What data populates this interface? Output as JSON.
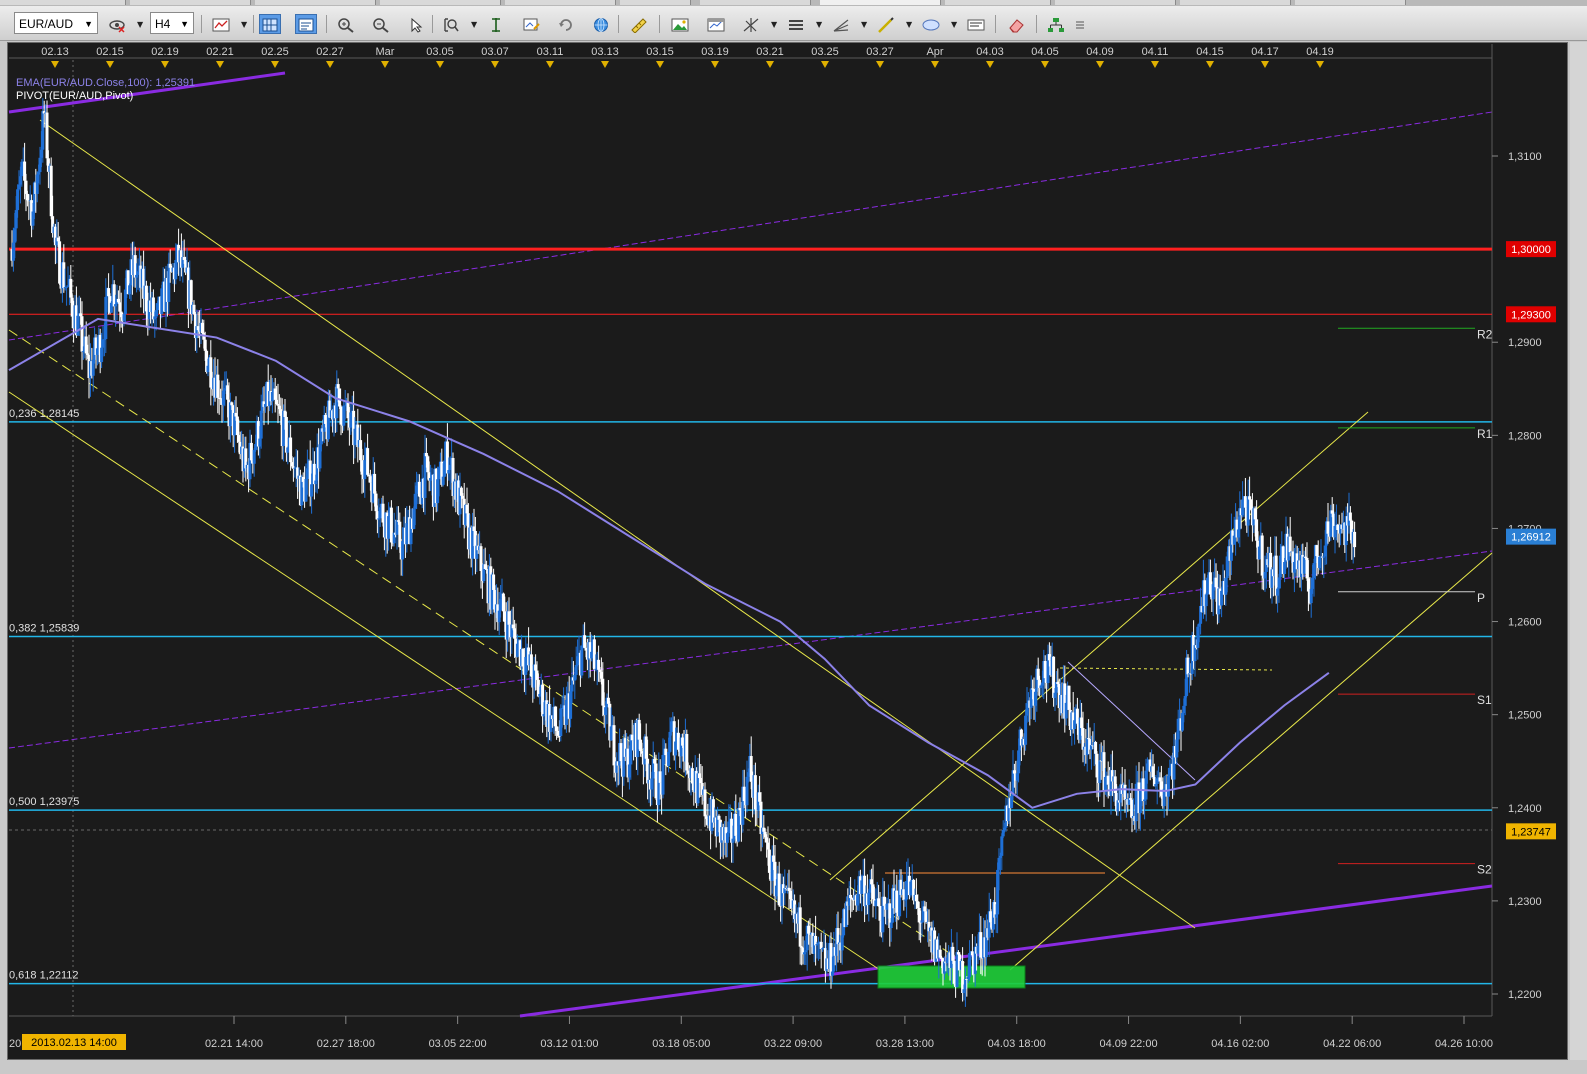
{
  "toolbar": {
    "symbol": "EUR/AUD",
    "timeframe": "H4",
    "tools": [
      {
        "name": "hide-icon",
        "dropdown": true
      },
      {
        "name": "chart-type-icon",
        "dropdown": true
      },
      {
        "name": "grid-icon",
        "active": true
      },
      {
        "name": "data-window-icon",
        "active": true
      },
      {
        "name": "zoom-in-icon"
      },
      {
        "name": "zoom-out-icon"
      },
      {
        "name": "cursor-icon"
      },
      {
        "name": "zoom-area-icon",
        "dropdown": true
      },
      {
        "name": "scale-icon"
      },
      {
        "name": "chart-settings-icon"
      },
      {
        "name": "refresh-icon"
      },
      {
        "name": "globe-icon"
      },
      {
        "name": "ruler-icon"
      },
      {
        "name": "image-icon"
      },
      {
        "name": "template-icon"
      },
      {
        "name": "crosshair-icon",
        "dropdown": true
      },
      {
        "name": "lines-icon",
        "dropdown": true
      },
      {
        "name": "fan-icon",
        "dropdown": true
      },
      {
        "name": "pen-icon",
        "dropdown": true
      },
      {
        "name": "ellipse-icon",
        "dropdown": true
      },
      {
        "name": "text-icon"
      },
      {
        "name": "eraser-icon"
      },
      {
        "name": "hierarchy-icon"
      },
      {
        "name": "menu-icon"
      }
    ]
  },
  "colors": {
    "background": "#1b1b1b",
    "bull": "#1e6fd6",
    "bear": "#ffffff",
    "ema": "#8c82e8",
    "fib": "#22b6e8",
    "red": "#ff2020",
    "purple": "#8a2be2",
    "yellow": "#e8e84a"
  },
  "legend": {
    "ema_label": "EMA(EUR/AUD.Close,100): 1,25391",
    "pivot_label": "PIVOT(EUR/AUD,Pivot)"
  },
  "top_dates": [
    "02.13",
    "02.15",
    "02.19",
    "02.21",
    "02.25",
    "02.27",
    "Mar",
    "03.05",
    "03.07",
    "03.11",
    "03.13",
    "03.15",
    "03.19",
    "03.21",
    "03.25",
    "03.27",
    "Apr",
    "04.03",
    "04.05",
    "04.09",
    "04.11",
    "04.15",
    "04.17",
    "04.19"
  ],
  "bottom_axis": {
    "prefix": "20",
    "cursor_label": "2013.02.13 14:00",
    "labels": [
      "02.21 14:00",
      "02.27 18:00",
      "03.05 22:00",
      "03.12 01:00",
      "03.18 05:00",
      "03.22 09:00",
      "03.28 13:00",
      "04.03 18:00",
      "04.09 22:00",
      "04.16 02:00",
      "04.22 06:00",
      "04.26 10:00"
    ]
  },
  "price_axis": {
    "min": 1.215,
    "max": 1.32,
    "ticks": [
      "1,3100",
      "1,2900",
      "1,2800",
      "1,2700",
      "1,2600",
      "1,2500",
      "1,2400",
      "1,2300",
      "1,2200"
    ],
    "tick_values": [
      1.31,
      1.29,
      1.28,
      1.27,
      1.26,
      1.25,
      1.24,
      1.23,
      1.22
    ]
  },
  "price_tags": [
    {
      "text": "1,30000",
      "value": 1.3,
      "color": "#e00000",
      "textcolor": "#ffffff"
    },
    {
      "text": "1,29300",
      "value": 1.293,
      "color": "#e00000",
      "textcolor": "#ffffff"
    },
    {
      "text": "1,26912",
      "value": 1.26912,
      "color": "#2a7fd4",
      "textcolor": "#ffffff"
    },
    {
      "text": "1,23747",
      "value": 1.23747,
      "color": "#f0b400",
      "textcolor": "#000000"
    }
  ],
  "fib_levels": [
    {
      "label": "0,236 1,28145",
      "value": 1.28145
    },
    {
      "label": "0,382 1,25839",
      "value": 1.25839
    },
    {
      "label": "0,500 1,23975",
      "value": 1.23975
    },
    {
      "label": "0,618 1,22112",
      "value": 1.22112
    }
  ],
  "pivot_levels": [
    {
      "label": "R2",
      "value": 1.2915,
      "color": "#22aa22"
    },
    {
      "label": "R1",
      "value": 1.2808,
      "color": "#22aa22"
    },
    {
      "label": "P",
      "value": 1.2632,
      "color": "#cfcfcf"
    },
    {
      "label": "S1",
      "value": 1.2522,
      "color": "#d02020"
    },
    {
      "label": "S2",
      "value": 1.234,
      "color": "#d02020"
    }
  ],
  "red_levels": [
    1.3,
    1.293
  ],
  "candle_path": [
    1.3,
    1.308,
    1.304,
    1.3145,
    1.3,
    1.296,
    1.292,
    1.287,
    1.29,
    1.296,
    1.294,
    1.298,
    1.295,
    1.292,
    1.296,
    1.299,
    1.295,
    1.29,
    1.287,
    1.284,
    1.281,
    1.276,
    1.28,
    1.284,
    1.282,
    1.278,
    1.274,
    1.276,
    1.28,
    1.284,
    1.282,
    1.279,
    1.276,
    1.272,
    1.27,
    1.268,
    1.272,
    1.276,
    1.274,
    1.278,
    1.273,
    1.269,
    1.266,
    1.263,
    1.261,
    1.258,
    1.256,
    1.253,
    1.25,
    1.248,
    1.252,
    1.257,
    1.256,
    1.251,
    1.246,
    1.245,
    1.248,
    1.244,
    1.242,
    1.248,
    1.247,
    1.243,
    1.24,
    1.238,
    1.236,
    1.239,
    1.244,
    1.238,
    1.233,
    1.23,
    1.228,
    1.226,
    1.224,
    1.223,
    1.226,
    1.23,
    1.232,
    1.23,
    1.228,
    1.23,
    1.232,
    1.229,
    1.226,
    1.224,
    1.223,
    1.222,
    1.224,
    1.226,
    1.23,
    1.24,
    1.246,
    1.252,
    1.255,
    1.254,
    1.252,
    1.249,
    1.247,
    1.245,
    1.243,
    1.241,
    1.239,
    1.242,
    1.244,
    1.242,
    1.246,
    1.254,
    1.26,
    1.265,
    1.262,
    1.268,
    1.273,
    1.27,
    1.266,
    1.265,
    1.268,
    1.266,
    1.264,
    1.268,
    1.271,
    1.27,
    1.2692
  ],
  "ema_points": [
    [
      0,
      1.287
    ],
    [
      0.06,
      1.2925
    ],
    [
      0.1,
      1.2915
    ],
    [
      0.14,
      1.2905
    ],
    [
      0.18,
      1.288
    ],
    [
      0.22,
      1.284
    ],
    [
      0.27,
      1.2815
    ],
    [
      0.32,
      1.278
    ],
    [
      0.37,
      1.274
    ],
    [
      0.42,
      1.269
    ],
    [
      0.47,
      1.264
    ],
    [
      0.52,
      1.26
    ],
    [
      0.55,
      1.256
    ],
    [
      0.58,
      1.251
    ],
    [
      0.62,
      1.247
    ],
    [
      0.66,
      1.2435
    ],
    [
      0.69,
      1.24
    ],
    [
      0.72,
      1.2415
    ],
    [
      0.75,
      1.242
    ],
    [
      0.78,
      1.2418
    ],
    [
      0.8,
      1.2425
    ],
    [
      0.83,
      1.247
    ],
    [
      0.86,
      1.251
    ],
    [
      0.89,
      1.2545
    ]
  ]
}
